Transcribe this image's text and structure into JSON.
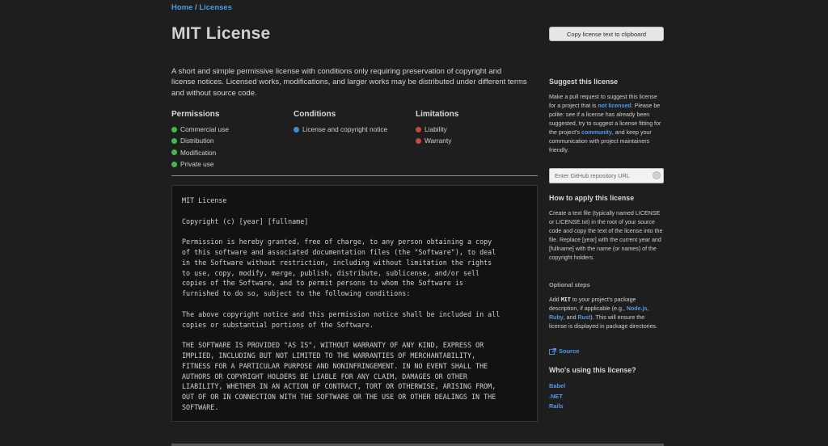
{
  "breadcrumb": {
    "home": "Home",
    "separator": " / ",
    "current": "Licenses"
  },
  "title": "MIT License",
  "copy_button": "Copy license text to clipboard",
  "description": "A short and simple permissive license with conditions only requiring preservation of copyright and license notices. Licensed works, modifications, and larger works may be distributed under different terms and without source code.",
  "rules": {
    "permissions": {
      "heading": "Permissions",
      "color": "#3fb950",
      "items": [
        "Commercial use",
        "Distribution",
        "Modification",
        "Private use"
      ]
    },
    "conditions": {
      "heading": "Conditions",
      "color": "#3b8fd9",
      "items": [
        "License and copyright notice"
      ]
    },
    "limitations": {
      "heading": "Limitations",
      "color": "#c9463d",
      "items": [
        "Liability",
        "Warranty"
      ]
    }
  },
  "license_text": {
    "p1": "MIT License",
    "p2": "Copyright (c) [year] [fullname]",
    "p3": "Permission is hereby granted, free of charge, to any person obtaining a copy\nof this software and associated documentation files (the \"Software\"), to deal\nin the Software without restriction, including without limitation the rights\nto use, copy, modify, merge, publish, distribute, sublicense, and/or sell\ncopies of the Software, and to permit persons to whom the Software is\nfurnished to do so, subject to the following conditions:",
    "p4": "The above copyright notice and this permission notice shall be included in all\ncopies or substantial portions of the Software.",
    "p5": "THE SOFTWARE IS PROVIDED \"AS IS\", WITHOUT WARRANTY OF ANY KIND, EXPRESS OR\nIMPLIED, INCLUDING BUT NOT LIMITED TO THE WARRANTIES OF MERCHANTABILITY,\nFITNESS FOR A PARTICULAR PURPOSE AND NONINFRINGEMENT. IN NO EVENT SHALL THE\nAUTHORS OR COPYRIGHT HOLDERS BE LIABLE FOR ANY CLAIM, DAMAGES OR OTHER\nLIABILITY, WHETHER IN AN ACTION OF CONTRACT, TORT OR OTHERWISE, ARISING FROM,\nOUT OF OR IN CONNECTION WITH THE SOFTWARE OR THE USE OR OTHER DEALINGS IN THE\nSOFTWARE."
  },
  "sidebar": {
    "suggest": {
      "heading": "Suggest this license",
      "text1": "Make a pull request to suggest this license for a project that is ",
      "link1": "not licensed",
      "text2": ". Please be polite: see if a license has already been suggested, try to suggest a license fitting for the project's ",
      "link2": "community",
      "text3": ", and keep your communication with project maintainers friendly.",
      "input_placeholder": "Enter GitHub repository URL"
    },
    "apply": {
      "heading": "How to apply this license",
      "text": "Create a text file (typically named LICENSE or LICENSE.txt) in the root of your source code and copy the text of the license into the file. Replace [year] with the current year and [fullname] with the name (or names) of the copyright holders.",
      "optional_title": "Optional steps",
      "opt_text1": "Add ",
      "opt_code": "MIT",
      "opt_text2": " to your project's package description, if applicable (e.g., ",
      "opt_link1": "Node.js",
      "opt_sep1": ", ",
      "opt_link2": "Ruby",
      "opt_sep2": ", and ",
      "opt_link3": "Rust",
      "opt_text3": "). This will ensure the license is displayed in package directories.",
      "source_link": "Source"
    },
    "users": {
      "heading": "Who's using this license?",
      "items": [
        "Babel",
        ".NET",
        "Rails"
      ]
    }
  },
  "icons": {
    "source": "external-link-icon",
    "input": "circle-icon"
  },
  "colors": {
    "link": "#4c9be8",
    "background": "#1e1e1e"
  }
}
